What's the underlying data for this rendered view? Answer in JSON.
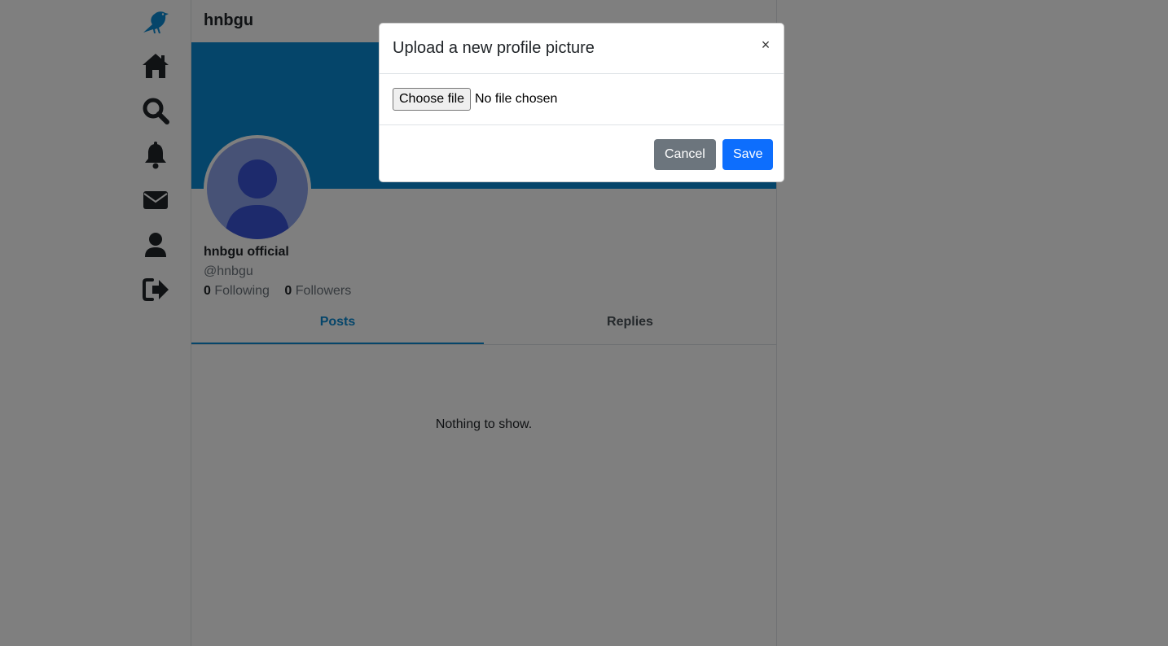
{
  "colors": {
    "brand": "#0a8bd4",
    "save": "#0d6efd",
    "cancel": "#6c757d"
  },
  "sidebar": {
    "items": [
      {
        "name": "logo",
        "icon": "bird-icon"
      },
      {
        "name": "home",
        "icon": "home-icon"
      },
      {
        "name": "search",
        "icon": "search-icon"
      },
      {
        "name": "notifications",
        "icon": "bell-icon"
      },
      {
        "name": "messages",
        "icon": "envelope-icon"
      },
      {
        "name": "profile",
        "icon": "user-icon"
      },
      {
        "name": "logout",
        "icon": "sign-out-icon"
      }
    ]
  },
  "header": {
    "title": "hnbgu"
  },
  "profile": {
    "display_name": "hnbgu official",
    "handle": "@hnbgu",
    "following_count": "0",
    "following_label": "Following",
    "followers_count": "0",
    "followers_label": "Followers"
  },
  "tabs": [
    {
      "label": "Posts",
      "active": true
    },
    {
      "label": "Replies",
      "active": false
    }
  ],
  "empty_message": "Nothing to show.",
  "modal": {
    "title": "Upload a new profile picture",
    "close_label": "×",
    "file_button_label": "Choose file",
    "file_status": "No file chosen",
    "cancel_label": "Cancel",
    "save_label": "Save"
  }
}
